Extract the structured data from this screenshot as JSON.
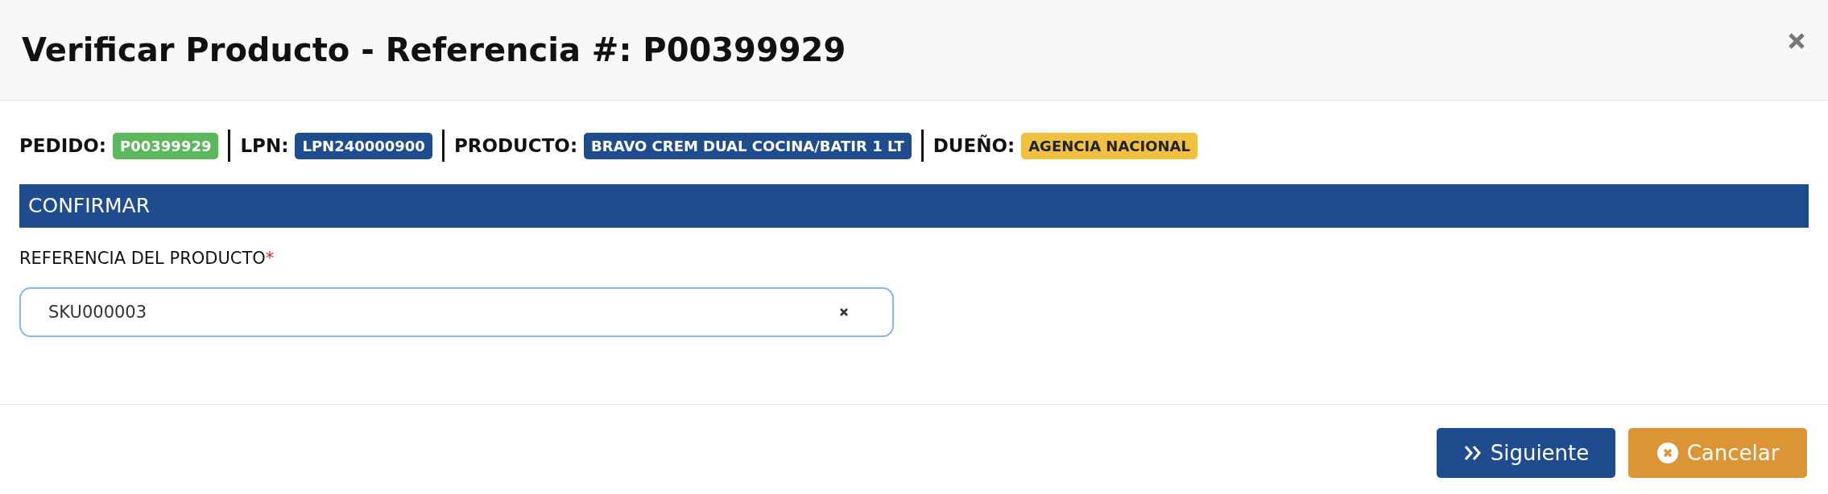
{
  "dialog": {
    "title": "Verificar Producto - Referencia #: P00399929"
  },
  "info": [
    {
      "label": "PEDIDO:",
      "value": "P00399929",
      "color": "#5cb85c"
    },
    {
      "label": "LPN:",
      "value": "LPN240000900",
      "color": "#1f4b8f"
    },
    {
      "label": "PRODUCTO:",
      "value": "BRAVO CREM DUAL COCINA/BATIR 1 LT",
      "color": "#1f4b8f"
    },
    {
      "label": "DUEÑO:",
      "value": "AGENCIA NACIONAL",
      "color": "#f0c040"
    }
  ],
  "section": {
    "title": "CONFIRMAR"
  },
  "field": {
    "label": "REFERENCIA DEL PRODUCTO",
    "required_mark": "*",
    "value": "SKU000003"
  },
  "buttons": [
    {
      "kind": "next",
      "label": "Siguiente"
    },
    {
      "kind": "cancel",
      "label": "Cancelar"
    }
  ]
}
